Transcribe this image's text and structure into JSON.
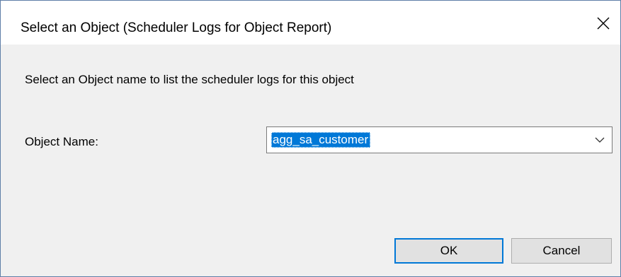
{
  "dialog": {
    "title": "Select an Object (Scheduler Logs for Object Report)",
    "close_icon": "close-icon",
    "instruction": "Select an Object name to list the scheduler logs for this object",
    "object_name_label": "Object Name:",
    "object_name_value": "agg_sa_customer",
    "dropdown_icon": "chevron-down-icon",
    "ok_label": "OK",
    "cancel_label": "Cancel"
  },
  "colors": {
    "selection": "#0078d7",
    "titlebar": "#ffffff",
    "body": "#f0f0f0",
    "default_button_border": "#0078d7"
  }
}
